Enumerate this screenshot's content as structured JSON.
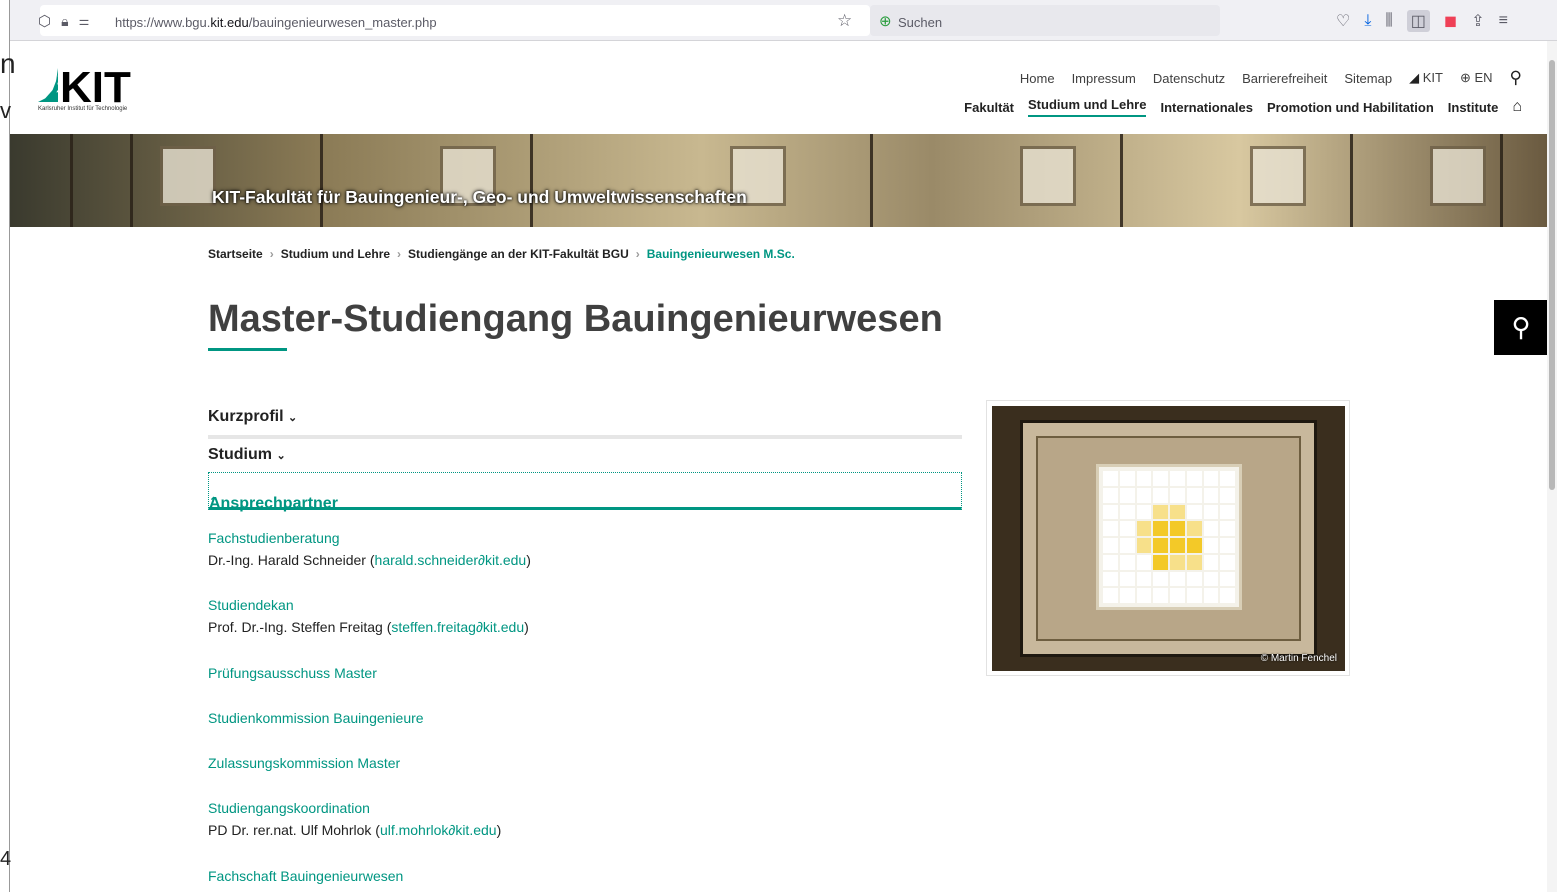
{
  "browser": {
    "url_prefix": "https://www.bgu.",
    "url_domain": "kit.edu",
    "url_path": "/bauingenieurwesen_master.php",
    "search_placeholder": "Suchen"
  },
  "left_fragments": [
    "n",
    "v",
    "4"
  ],
  "site": {
    "logo_text": "KIT",
    "logo_subtitle": "Karlsruher Institut für Technologie",
    "meta_nav": [
      "Home",
      "Impressum",
      "Datenschutz",
      "Barrierefreiheit",
      "Sitemap",
      "KIT",
      "EN"
    ],
    "main_nav": [
      "Fakultät",
      "Studium und Lehre",
      "Internationales",
      "Promotion und Habilitation",
      "Institute"
    ],
    "hero_title": "KIT-Fakultät für Bauingenieur-, Geo- und Umweltwissenschaften"
  },
  "breadcrumb": [
    "Startseite",
    "Studium und Lehre",
    "Studiengänge an der KIT-Fakultät BGU",
    "Bauingenieurwesen M.Sc."
  ],
  "page_title": "Master-Studiengang Bauingenieurwesen",
  "accordion": {
    "kurzprofil": "Kurzprofil",
    "studium": "Studium",
    "ansprechpartner": "Ansprechpartner"
  },
  "contacts": [
    {
      "role": "Fachstudienberatung",
      "name": "Dr.-Ing. Harald Schneider (",
      "email": "harald.schneider∂kit.edu",
      "close": ")"
    },
    {
      "role": "Studiendekan",
      "name": "Prof. Dr.-Ing. Steffen Freitag (",
      "email": "steffen.freitag∂kit.edu",
      "close": ")"
    },
    {
      "role": "Prüfungsausschuss Master"
    },
    {
      "role": "Studienkommission Bauingenieure"
    },
    {
      "role": "Zulassungskommission Master"
    },
    {
      "role": "Studiengangskoordination",
      "name": "PD Dr. rer.nat. Ulf Mohrlok (",
      "email": "ulf.mohrlok∂kit.edu",
      "close": ")"
    },
    {
      "role": "Fachschaft Bauingenieurwesen"
    }
  ],
  "figure": {
    "copyright": "© Martin Fenchel"
  },
  "colors": {
    "kit_green": "#009682"
  }
}
